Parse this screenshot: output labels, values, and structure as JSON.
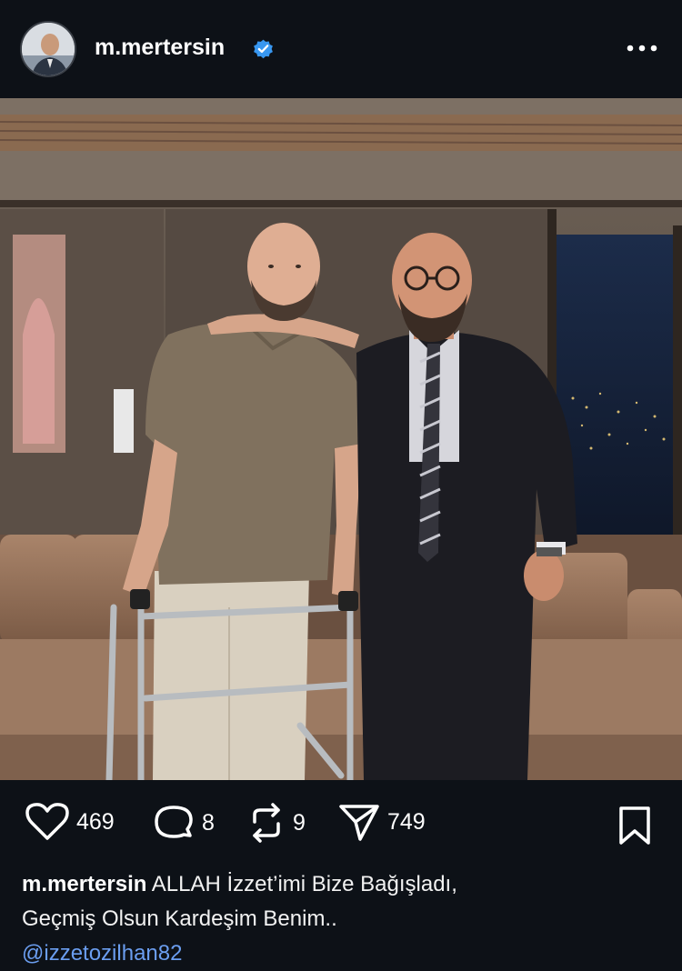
{
  "post": {
    "username": "m.mertersin",
    "verified": true,
    "caption_line1": "ALLAH İzzet’imi Bize Bağışladı,",
    "caption_line2": "Geçmiş Olsun Kardeşim Benim..",
    "mention": "@izzetozilhan82"
  },
  "actions": {
    "likes": "469",
    "comments": "8",
    "reposts": "9",
    "shares": "749"
  },
  "colors": {
    "background": "#0d1117",
    "verified_blue": "#3897f0",
    "mention_blue": "#6b9ef0"
  },
  "icons": [
    "verified-badge-icon",
    "more-options-icon",
    "heart-icon",
    "comment-icon",
    "repost-icon",
    "share-icon",
    "bookmark-icon"
  ]
}
